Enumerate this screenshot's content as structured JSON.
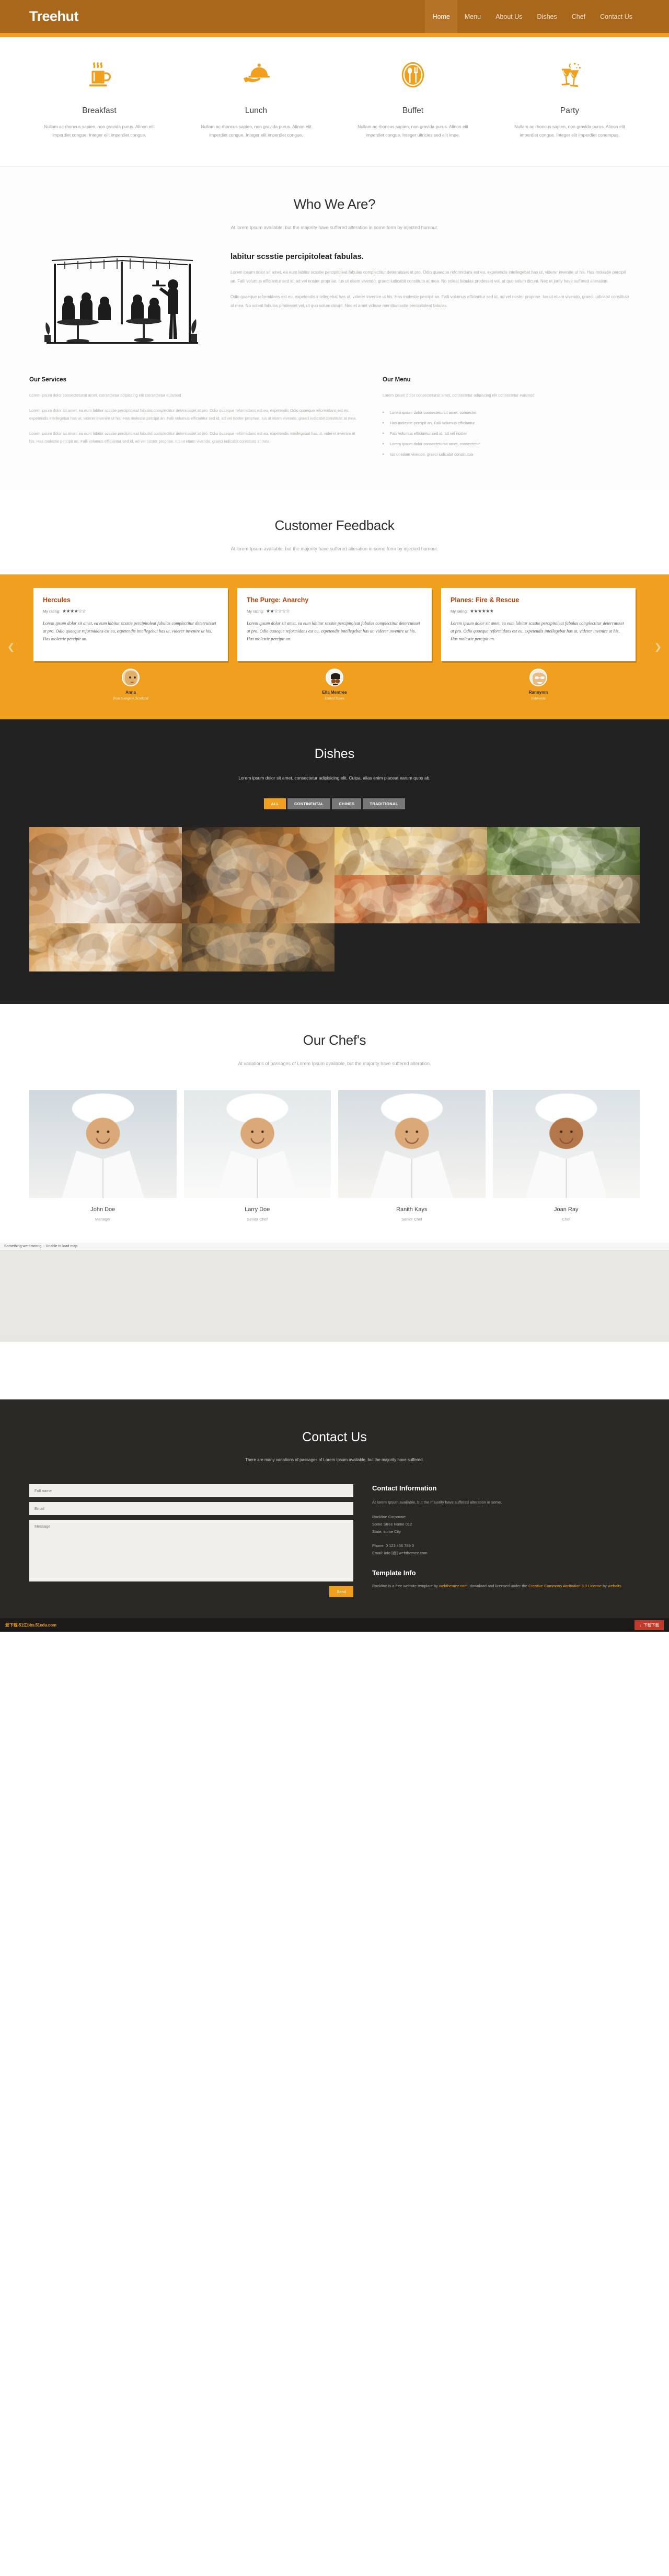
{
  "header": {
    "brand": "Treehut",
    "nav": [
      {
        "label": "Home",
        "active": true
      },
      {
        "label": "Menu",
        "active": false
      },
      {
        "label": "About Us",
        "active": false
      },
      {
        "label": "Dishes",
        "active": false
      },
      {
        "label": "Chef",
        "active": false
      },
      {
        "label": "Contact Us",
        "active": false
      }
    ]
  },
  "services": [
    {
      "icon": "coffee-cup-icon",
      "title": "Breakfast",
      "desc": "Nullam ac rhoncus sapien, non gravida purus. Alinon elit imperdiet congue. Integer elit imperdiet congue."
    },
    {
      "icon": "serving-tray-icon",
      "title": "Lunch",
      "desc": "Nullam ac rhoncus sapien, non gravida purus. Alinon elit imperdiet congue. Integer elit imperdiet congue."
    },
    {
      "icon": "spoon-fork-icon",
      "title": "Buffet",
      "desc": "Nullam ac rhoncus sapien, non gravida purus. Alinon elit imperdiet congue. Integer ultricies sed elit impe."
    },
    {
      "icon": "cheers-glasses-icon",
      "title": "Party",
      "desc": "Nullam ac rhoncus sapien, non gravida purus. Alinon elit imperdiet congue. Integer elit imperdiet conempus."
    }
  ],
  "whoweare": {
    "title": "Who We Are?",
    "subtitle": "At lorem Ipsum available, but the majority have suffered alteration in some form by injected humour.",
    "about_heading": "labitur scsstie percipitoleat fabulas.",
    "about_p1": "Lorem ipsum dolor sit amet, ea eum labitur scsstie percipitoleat fabulas complectitur deterruisset at pro. Odio quaeque reformidans est eu, expetendis intellegebat has ut, viderer invenire ut his. Has molestie percipit an. Falli volumus efficiantur sed id, ad vel noster propriae. Ius ut etiam vivendo, graeci iudicabit constituto at mea. No soleat fabulas prodesset vel, ut quo solum dicunt. Nec et jority have suffered alteration.",
    "about_p2": "Odio quaeque reformidans est eu, expetendis intellegebat has ut, viderer invenire ut his. Has molestie percipit an. Falli volumus efficiantur sed id, ad vel noster propriae. Ius ut etiam vivendo, graeci iudicabit constituto at mea. No soleat fabulas prodesset vel, ut quo solum dicunt. Nec et amet vidisse mentitumsstie percipitoleat fabulas."
  },
  "our_services": {
    "heading": "Our Services",
    "lead": "Lorem ipsum dolor consectetursit amet, consectetur adipiscing elit consectetur euismod",
    "p1": "Lorem ipsum dolor sit amet, ea eum labitur scsstie percipitoleat fabulas complectitur deterruisset at pro. Odio quaeque reformidans est eu, expetendis Odio quaeque reformidans est eu, expetendis intellegebat has ut, viderer invenire ut his. Has molestie percipit an. Falli volumus efficiantur sed id, ad vel noster propriae. Ius ut etiam vivendo, graeci iudicabit constituto at mea.",
    "p2": "Lorem ipsum dolor sit amet, ea eum labitur scsstie percipitoleat fabulas complectitur deterruisset at pro. Odio quaeque reformidans est eu, expetendis intellegebat has ut, viderer invenire ut his. Has molestie percipit an. Falli volumus efficiantur sed id, ad vel noster propriae. Ius ut etiam vivendo, graeci iudicabit constituto at mea."
  },
  "our_menu": {
    "heading": "Our Menu",
    "lead": "Lorem ipsum dolor consectetursit amet, consectetur adipiscing elit consectetur euismod",
    "items": [
      "Lorem ipsum dolor consectetursit amet, consectet",
      "Has molestie percipit an. Falli volumus efficiantur",
      "Falli volumus efficiantur sed id, ad vel noster",
      "Lorem ipsum dolor consectetursit amet, consectetur",
      "Ius ut etiam vivendo, graeci iudicabit constitutoa"
    ]
  },
  "feedback": {
    "title": "Customer Feedback",
    "subtitle": "At lorem Ipsum available, but the majority have suffered alteration in some form by injected humour.",
    "prev_arrow": "❮",
    "next_arrow": "❯",
    "rating_label": "My rating:",
    "cards": [
      {
        "name": "Hercules",
        "stars": "★★★★☆☆",
        "rating_value": 4,
        "quote": "Lorem ipsum dolor sit amet, ea eum labitur scsstie percipitoleat fabulas complectitur deterruisset at pro. Odio quaeque reformidans est eu, expetendis intellegebat has ut, viderer invenire ut his. Has molestie percipit an.",
        "person": "Anna",
        "location": "from Glasgow, Scotland",
        "avatar": "woman-blonde-avatar"
      },
      {
        "name": "The Purge: Anarchy",
        "stars": "★★☆☆☆☆",
        "rating_value": 2,
        "quote": "Lorem ipsum dolor sit amet, ea eum labitur scsstie percipitoleat fabulas complectitur deterruisset at pro. Odio quaeque reformidans est eu, expetendis intellegebat has ut, viderer invenire ut his. Has molestie percipit an.",
        "person": "Ella Mentree",
        "location": "United States",
        "avatar": "man-binoculars-avatar"
      },
      {
        "name": "Planes: Fire & Rescue",
        "stars": "★★★★★★",
        "rating_value": 6,
        "quote": "Lorem ipsum dolor sit amet, ea eum labitur scsstie percipitoleat fabulas complectitur deterruisset at pro. Odio quaeque reformidans est eu, expetendis intellegebat has ut, viderer invenire ut his. Has molestie percipit an.",
        "person": "Rannynm",
        "location": "Indonesia",
        "avatar": "woman-glasses-avatar"
      }
    ]
  },
  "dishes": {
    "title": "Dishes",
    "subtitle": "Lorem ipsum dolor sit amet, consectetur adipisicing elit. Culpa, alias enim placeat earum quos ab.",
    "filters": [
      {
        "label": "ALL",
        "active": true
      },
      {
        "label": "CONTINENTAL",
        "active": false
      },
      {
        "label": "CHINES",
        "active": false
      },
      {
        "label": "TRADITIONAL",
        "active": false
      }
    ],
    "gallery": [
      {
        "name": "dish-photo-plated-meat",
        "palette": [
          "#c98a4a",
          "#f2e8da",
          "#7b4a22"
        ],
        "span": 2
      },
      {
        "name": "dish-photo-roast-chicken",
        "palette": [
          "#2a2320",
          "#b07436",
          "#e0c79a"
        ],
        "span": 1
      },
      {
        "name": "dish-photo-fries-platter",
        "palette": [
          "#e8c169",
          "#f4ead4",
          "#8e6430"
        ],
        "span": 1
      },
      {
        "name": "dish-photo-salad-bowl",
        "palette": [
          "#6f8c3a",
          "#d9dfc2",
          "#3c4f1e"
        ],
        "span": 1
      },
      {
        "name": "dish-photo-croissant",
        "palette": [
          "#d9a05b",
          "#f6ecd9",
          "#8a5c26"
        ],
        "span": 1
      },
      {
        "name": "dish-photo-grilled-fish",
        "palette": [
          "#5c4a33",
          "#c59b60",
          "#2e2720"
        ],
        "span": 1
      },
      {
        "name": "dish-photo-pizza",
        "palette": [
          "#c75b2b",
          "#f0d9a8",
          "#7d3a17"
        ],
        "span": 1
      },
      {
        "name": "dish-photo-rice-dish",
        "palette": [
          "#8c6a3a",
          "#efe2c6",
          "#4d3a1f"
        ],
        "span": 1
      }
    ]
  },
  "chefs": {
    "title": "Our Chef's",
    "subtitle": "At variations of passages of Lorem Ipsum available, but the majority have suffered alteration.",
    "people": [
      {
        "name": "John Doe",
        "role": "Manager",
        "photo": "chef-portrait-1"
      },
      {
        "name": "Larry Doe",
        "role": "Senior Chef",
        "photo": "chef-portrait-2"
      },
      {
        "name": "Ranith Kays",
        "role": "Senior Chef",
        "photo": "chef-portrait-3"
      },
      {
        "name": "Joan Ray",
        "role": "Chef",
        "photo": "chef-portrait-4"
      }
    ]
  },
  "map": {
    "error_text": "Something went wrong. - Unable to load map"
  },
  "contact": {
    "title": "Contact Us",
    "subtitle": "There are many variations of passages of Lorem Ipsum available, but the majority have suffered.",
    "form": {
      "name_placeholder": "Full name",
      "email_placeholder": "Email",
      "message_placeholder": "Message",
      "send_label": "Send"
    },
    "info": {
      "heading": "Contact Information",
      "description": "At lorem Ipsum available, but the majority have suffered alteration in some.",
      "company": "Rockline Corporate",
      "street": "Some Stree Name 012",
      "city": "State, some City",
      "phone": "Phone: 0 123 456 789 0",
      "email": "Email: info [@] webthemez.com"
    },
    "template_info": {
      "heading": "Template Info",
      "text_before": "Rockline is a free website template by",
      "link1": "webthemez.com",
      "text_mid": ". download and licensed under the",
      "link2": "Creative Commons Attribution 3.0 License",
      "text_after": "by",
      "link3": "webalts"
    }
  },
  "bottom_bar": {
    "left_text": "爱下载-51江bbs.51edu.com",
    "right_chip_text": "下载下载",
    "right_chip_icon": "download-icon"
  }
}
